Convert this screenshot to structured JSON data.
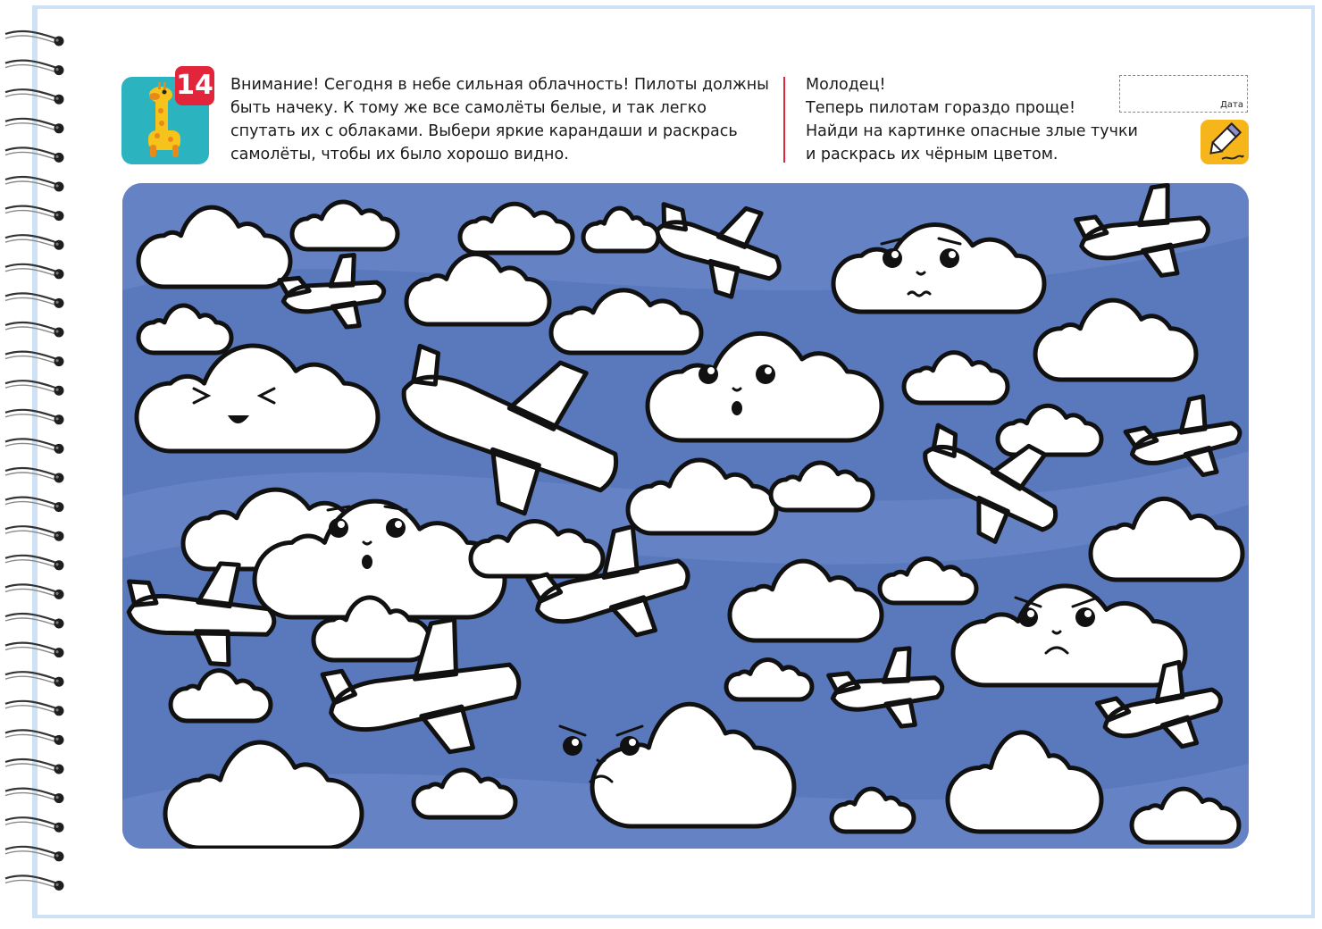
{
  "task_number": "14",
  "task_text": "Внимание! Сегодня в небе сильная облачность! Пилоты должны быть начеку. К тому же все самолёты белые, и так легко спутать их с облаками. Выбери яркие карандаши и раскрась самолёты, чтобы их было хорошо видно.",
  "task2_lines": [
    "Молодец!",
    "Теперь пилотам гораздо проще!",
    "Найди на картинке опасные злые тучки",
    "и раскрась их чёрным цветом."
  ],
  "date_label": "Дата",
  "icons": {
    "tile": "giraffe-icon",
    "tool": "pencil-icon"
  },
  "colors": {
    "badge": "#e2253b",
    "tile": "#2bb3c0",
    "sky": "#5a78bc",
    "tool": "#f7b51c"
  }
}
